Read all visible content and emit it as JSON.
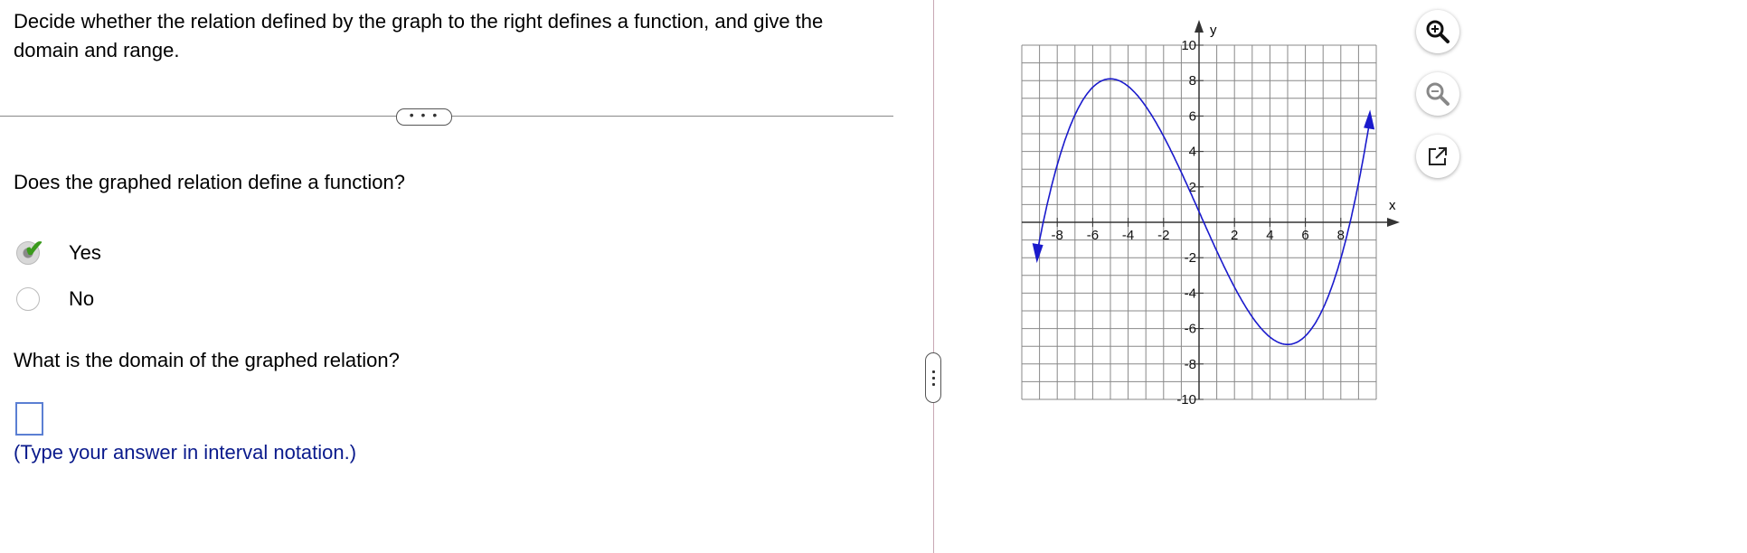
{
  "question": {
    "prompt": "Decide whether the relation defined by the graph to the right defines a function, and give the domain and range.",
    "more_button_label": "• • •",
    "q1": "Does the graphed relation define a function?",
    "options": [
      {
        "label": "Yes",
        "selected": true,
        "marked_correct": true
      },
      {
        "label": "No",
        "selected": false
      }
    ],
    "q2": "What is the domain of the graphed relation?",
    "answer_value": "",
    "hint": "(Type your answer in interval notation.)"
  },
  "graph": {
    "x_axis_label": "x",
    "y_axis_label": "y",
    "x_ticks": [
      "-8",
      "-6",
      "-4",
      "-2",
      "2",
      "4",
      "6",
      "8"
    ],
    "y_ticks": [
      "10",
      "8",
      "6",
      "4",
      "2",
      "-2",
      "-4",
      "-6",
      "-8",
      "-10"
    ],
    "curve_color": "#1a1acc"
  },
  "tools": [
    {
      "name": "zoom-in-icon"
    },
    {
      "name": "zoom-out-icon"
    },
    {
      "name": "open-external-icon"
    }
  ]
}
